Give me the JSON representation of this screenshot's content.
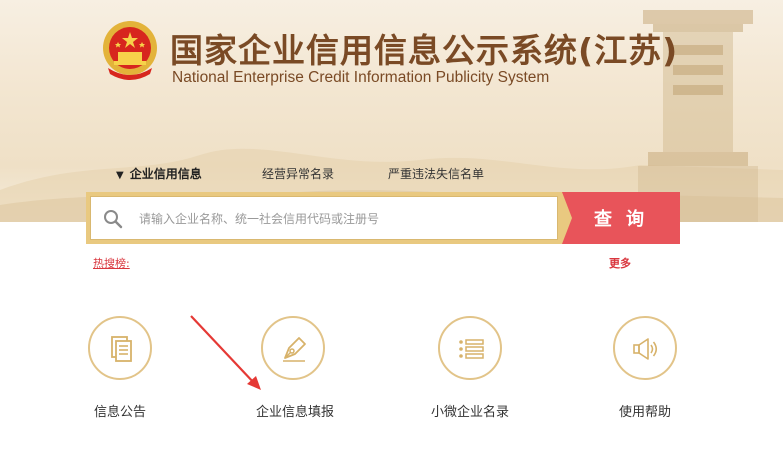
{
  "header": {
    "title_cn": "国家企业信用信息公示系统(江苏)",
    "title_en": "National Enterprise Credit Information Publicity System"
  },
  "nav": {
    "items": [
      {
        "label": "企业信用信息",
        "active": true
      },
      {
        "label": "经营异常名录",
        "active": false
      },
      {
        "label": "严重违法失信名单",
        "active": false
      }
    ]
  },
  "search": {
    "placeholder": "请输入企业名称、统一社会信用代码或注册号",
    "button_label": "查询"
  },
  "hot_search": {
    "label": "热搜榜:",
    "more_label": "更多"
  },
  "tiles": [
    {
      "label": "信息公告",
      "icon": "document-icon"
    },
    {
      "label": "企业信息填报",
      "icon": "pen-nib-icon"
    },
    {
      "label": "小微企业名录",
      "icon": "list-icon"
    },
    {
      "label": "使用帮助",
      "icon": "speaker-icon"
    }
  ],
  "colors": {
    "brand_brown": "#7a4a25",
    "search_gold": "#e9c980",
    "search_button_red": "#e8545a",
    "link_red": "#d9363e",
    "tile_border_gold": "#e2c489",
    "annotation_arrow": "#e53935"
  }
}
